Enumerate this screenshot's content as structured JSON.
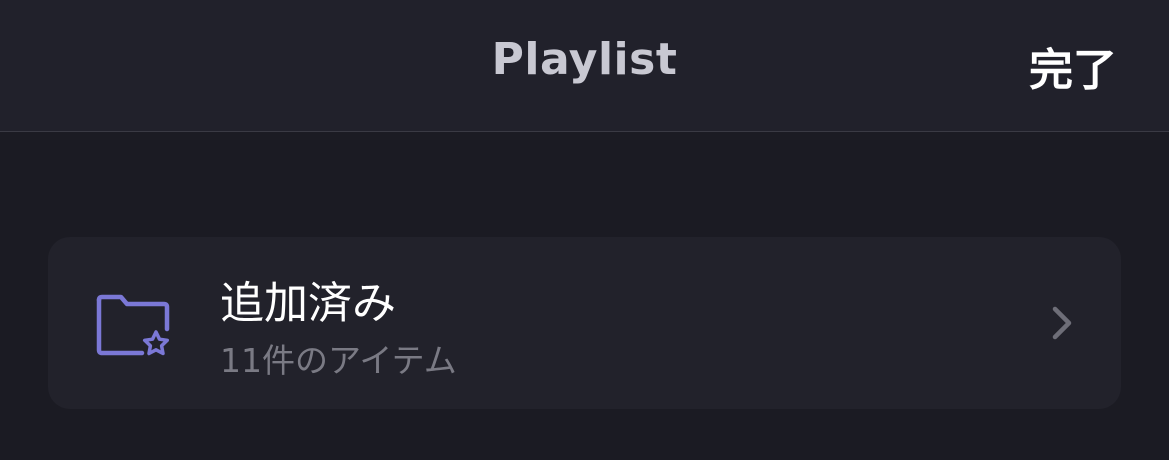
{
  "nav": {
    "title": "Playlist",
    "done_label": "完了"
  },
  "playlist_items": [
    {
      "title": "追加済み",
      "subtitle": "11件のアイテム",
      "icon": "folder-star-icon"
    }
  ],
  "colors": {
    "background": "#1b1b23",
    "nav_background": "#21212b",
    "card_background": "#22222b",
    "accent_icon": "#7b78d6",
    "secondary_text": "#7a7a84",
    "chevron": "#6e6e78"
  }
}
